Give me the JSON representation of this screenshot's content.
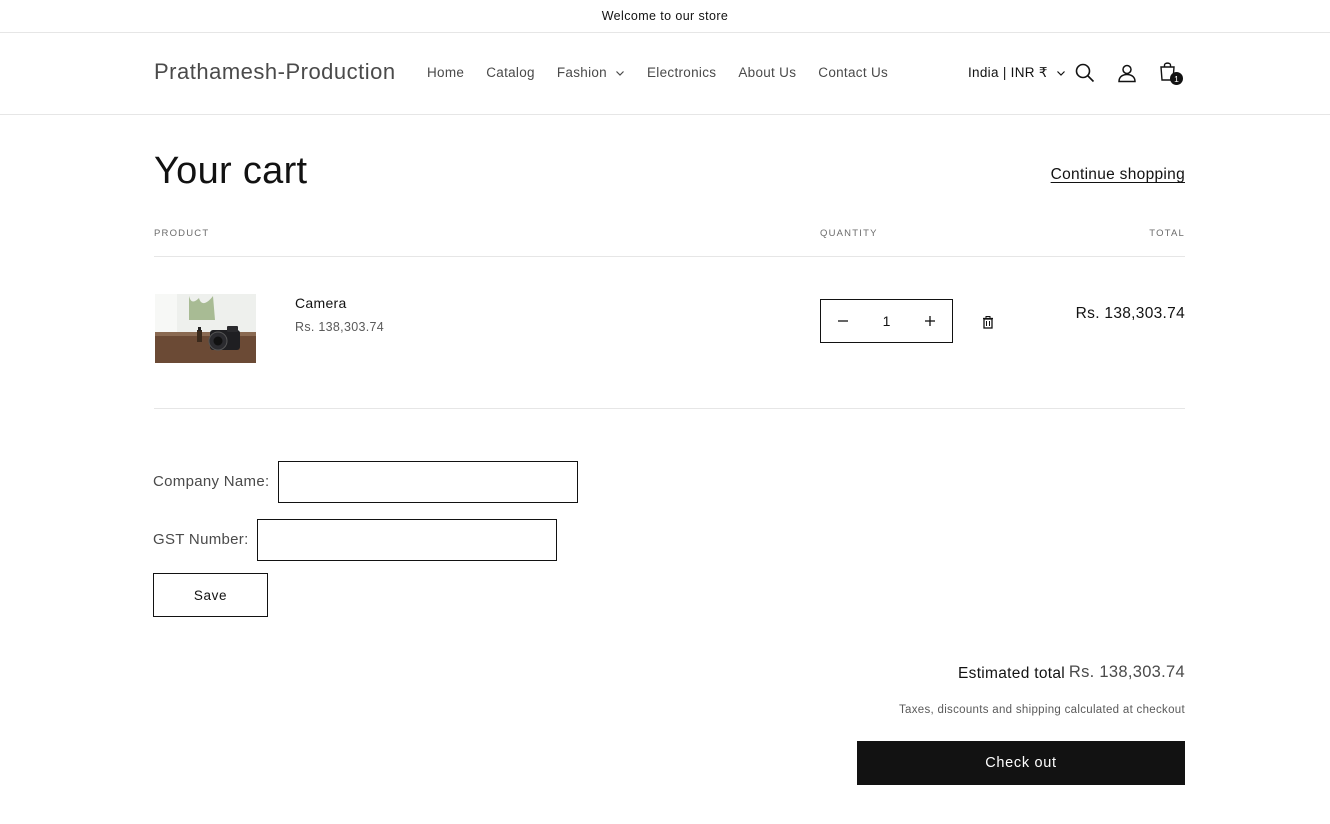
{
  "announcement": {
    "text": "Welcome to our store"
  },
  "header": {
    "logo": "Prathamesh-Production",
    "nav": [
      {
        "label": "Home"
      },
      {
        "label": "Catalog"
      },
      {
        "label": "Fashion",
        "has_dropdown": true
      },
      {
        "label": "Electronics"
      },
      {
        "label": "About Us"
      },
      {
        "label": "Contact Us"
      }
    ],
    "localization": "India | INR ₹",
    "cart_count": "1",
    "icons": [
      "search-icon",
      "account-icon",
      "cart-icon"
    ]
  },
  "cart": {
    "title": "Your cart",
    "continue_shopping": "Continue shopping",
    "columns": {
      "product": "PRODUCT",
      "quantity": "QUANTITY",
      "total": "TOTAL"
    },
    "items": [
      {
        "name": "Camera",
        "price": "Rs. 138,303.74",
        "quantity": "1",
        "total": "Rs. 138,303.74"
      }
    ]
  },
  "form": {
    "company_label": "Company Name:",
    "company_value": "",
    "gst_label": "GST Number:",
    "gst_value": "",
    "save_label": "Save"
  },
  "summary": {
    "estimated_label": "Estimated total",
    "estimated_value": "Rs. 138,303.74",
    "tax_note": "Taxes, discounts and shipping calculated at checkout",
    "checkout_label": "Check out"
  },
  "colors": {
    "primary": "#121212",
    "muted": "#4a4a4a",
    "border": "#e6e6e6",
    "background": "#ffffff"
  }
}
